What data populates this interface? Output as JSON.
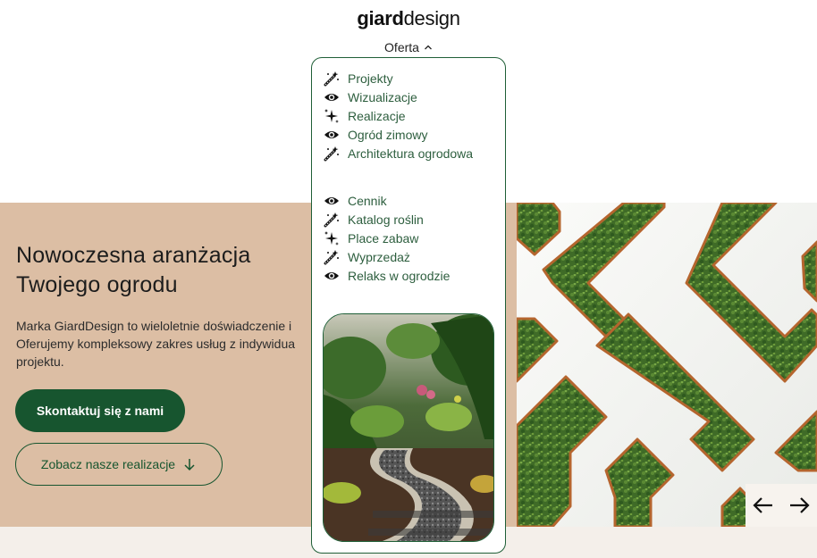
{
  "header": {
    "logo_bold": "giard",
    "logo_light": "design",
    "nav_offer": "Oferta"
  },
  "dropdown": {
    "group1": [
      {
        "label": "Projekty",
        "icon": "magic-wand-icon"
      },
      {
        "label": "Wizualizacje",
        "icon": "eye-icon"
      },
      {
        "label": "Realizacje",
        "icon": "sparkles-icon"
      },
      {
        "label": "Ogród zimowy",
        "icon": "eye-icon"
      },
      {
        "label": "Architektura ogrodowa",
        "icon": "magic-wand-icon"
      }
    ],
    "group2": [
      {
        "label": "Cennik",
        "icon": "eye-icon"
      },
      {
        "label": "Katalog roślin",
        "icon": "magic-wand-icon"
      },
      {
        "label": "Place zabaw",
        "icon": "sparkles-icon"
      },
      {
        "label": "Wyprzedaż",
        "icon": "magic-wand-icon"
      },
      {
        "label": "Relaks w ogrodzie",
        "icon": "eye-icon"
      }
    ]
  },
  "hero": {
    "title_line1": "Nowoczesna aranżacja",
    "title_line2": "Twojego ogrodu",
    "desc_line1": "Marka GiardDesign to wieloletnie doświadczenie i",
    "desc_line2": "Oferujemy kompleksowy zakres usług z indywidua",
    "desc_line3": "projektu.",
    "cta_primary": "Skontaktuj się z nami",
    "cta_secondary": "Zobacz nasze realizacje"
  },
  "colors": {
    "brand_green": "#17552f",
    "hero_bg": "#dcbea4",
    "menu_text": "#2d5e3e"
  }
}
